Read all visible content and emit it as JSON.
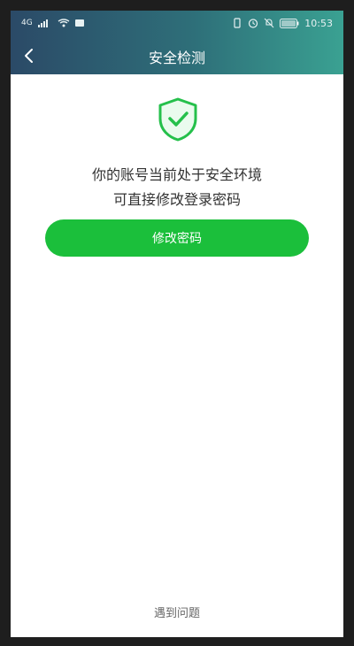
{
  "status_bar": {
    "left_signal": "4G",
    "time": "10:53"
  },
  "nav": {
    "title": "安全检测"
  },
  "content": {
    "line1": "你的账号当前处于安全环境",
    "line2": "可直接修改登录密码",
    "button_label": "修改密码"
  },
  "footer": {
    "help_label": "遇到问题"
  },
  "colors": {
    "header_start": "#2b4a67",
    "header_end": "#3aa192",
    "accent_green": "#1bbf3b",
    "shield_green": "#25c04b"
  },
  "icons": {
    "back": "back-chevron-icon",
    "shield": "shield-check-icon",
    "wifi": "wifi-icon",
    "signal": "signal-icon",
    "alarm": "alarm-icon",
    "battery": "battery-icon"
  }
}
